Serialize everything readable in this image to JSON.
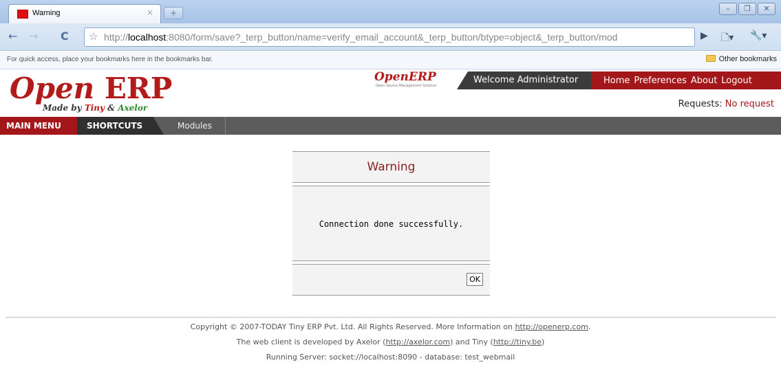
{
  "browser": {
    "tab_title": "Warning",
    "tab_close": "×",
    "new_tab": "+",
    "url_prefix": "http://",
    "url_host": "localhost",
    "url_rest": ":8080/form/save?_terp_button/name=verify_email_account&_terp_button/btype=object&_terp_button/mod",
    "bookmarks_hint": "For quick access, place your bookmarks here in the bookmarks bar.",
    "other_bookmarks": "Other bookmarks",
    "win_min": "–",
    "win_max": "❐",
    "win_close": "✕"
  },
  "header": {
    "logo_open": "Open",
    "logo_erp": "ERP",
    "logo_made_by": "Made by ",
    "logo_tiny": "Tiny",
    "logo_amp": " & ",
    "logo_axelor": "Axelor",
    "small_logo": "OpenERP",
    "small_logo_sub": "Open Source Management Solution",
    "welcome": "Welcome Administrator",
    "links": [
      "Home",
      "Preferences",
      "About",
      "Logout"
    ],
    "requests_label": "Requests: ",
    "requests_value": "No request"
  },
  "menu": {
    "main_menu": "MAIN MENU",
    "shortcuts": "SHORTCUTS",
    "modules": "Modules"
  },
  "dialog": {
    "title": "Warning",
    "message": "Connection done successfully.",
    "ok_label": "OK"
  },
  "footer": {
    "line1_text": "Copyright © 2007-TODAY Tiny ERP Pvt. Ltd. All Rights Reserved. More Information on ",
    "line1_link": "http://openerp.com",
    "line1_end": ".",
    "line2_a": "The web client is developed by Axelor (",
    "line2_link1": "http://axelor.com",
    "line2_b": ") and Tiny (",
    "line2_link2": "http://tiny.be",
    "line2_c": ")",
    "line3": "Running Server: socket://localhost:8090 - database: test_webmail"
  }
}
